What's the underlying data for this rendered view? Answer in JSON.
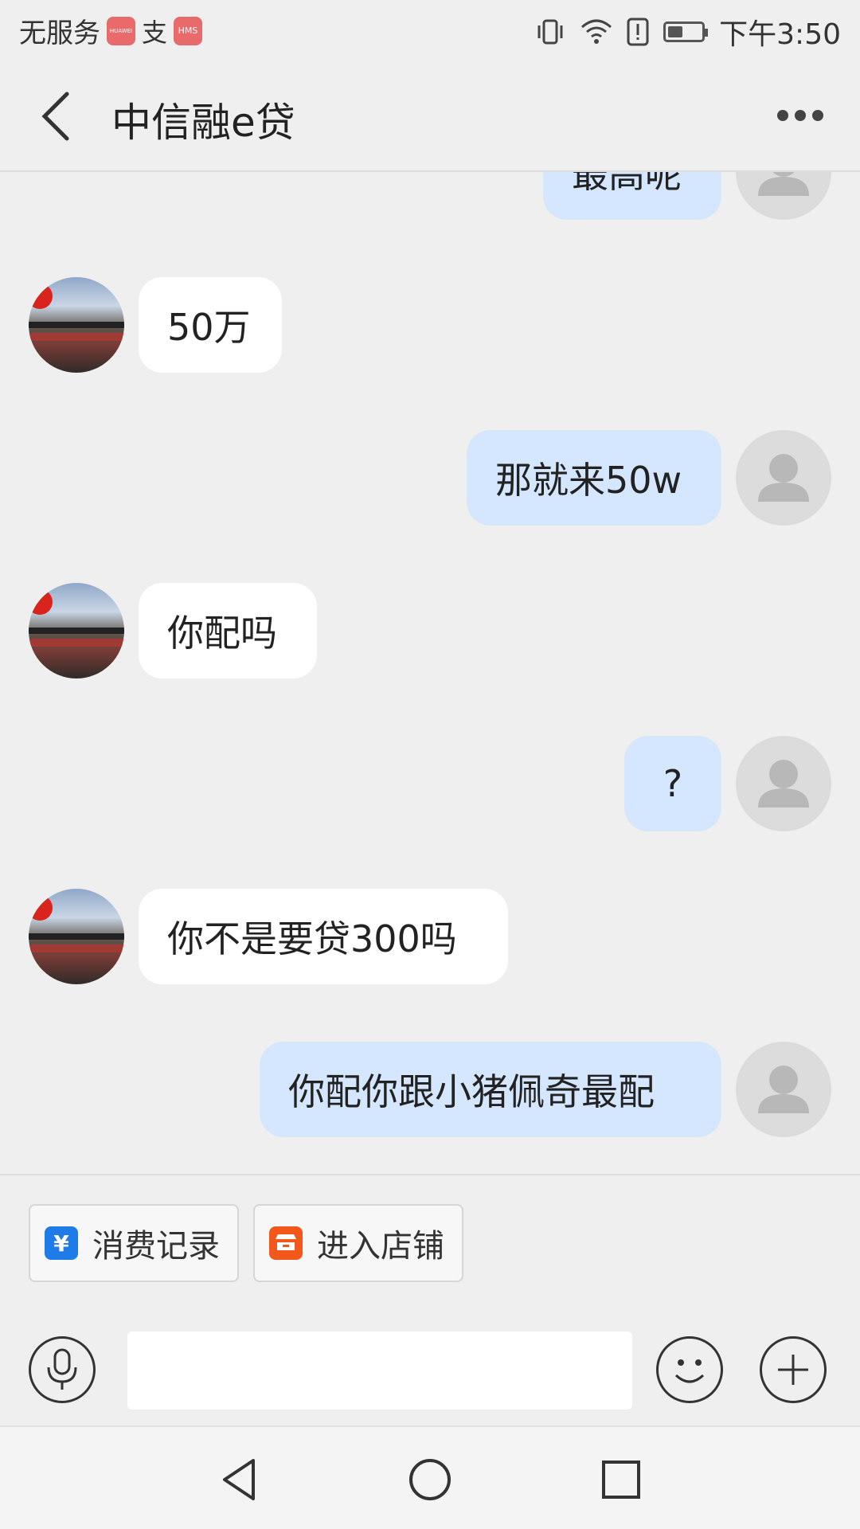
{
  "status_bar": {
    "carrier": "无服务",
    "time": "下午3:50",
    "icons": [
      "huawei-app-icon",
      "alipay-icon",
      "hms-icon",
      "vibrate-icon",
      "wifi-icon",
      "alert-icon",
      "battery-icon"
    ],
    "badges": {
      "huawei": "HUAWEI",
      "hms": "HMS",
      "alipay": "支"
    }
  },
  "header": {
    "title": "中信融e贷"
  },
  "chat": {
    "partial_top_text": "最高呢",
    "messages": [
      {
        "side": "in",
        "text": "50万"
      },
      {
        "side": "out",
        "text": "那就来50w"
      },
      {
        "side": "in",
        "text": "你配吗"
      },
      {
        "side": "out",
        "text": "?"
      },
      {
        "side": "in",
        "text": "你不是要贷300吗"
      },
      {
        "side": "out",
        "text": "你配你跟小猪佩奇最配"
      }
    ]
  },
  "quick_actions": [
    {
      "label": "消费记录",
      "icon": "receipt-yen-icon",
      "color": "#1e7be8"
    },
    {
      "label": "进入店铺",
      "icon": "store-icon",
      "color": "#f2581c"
    }
  ],
  "input": {
    "placeholder": "",
    "value": ""
  },
  "colors": {
    "outgoing_bubble": "#d5e6ff",
    "incoming_bubble": "#ffffff",
    "background": "#efefef"
  }
}
